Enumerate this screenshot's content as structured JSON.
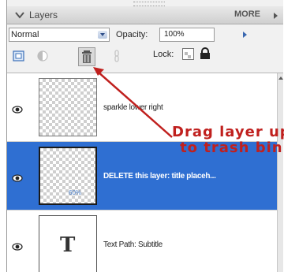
{
  "panel": {
    "title": "Layers",
    "more_label": "MORE",
    "blend_mode": "Normal",
    "opacity_label": "Opacity:",
    "opacity_value": "100%",
    "lock_label": "Lock:"
  },
  "toolbar": {
    "icons": [
      "new-layer-icon",
      "adjustment-layer-icon",
      "trash-icon",
      "link-icon",
      "lock-transparent-icon",
      "lock-all-icon"
    ]
  },
  "layers": [
    {
      "name": "sparkle lower right",
      "selected": false,
      "thumb": "transparent"
    },
    {
      "name": "DELETE this layer: title placeh...",
      "selected": true,
      "thumb": "transparent",
      "thumb_mark": "60%"
    },
    {
      "name": "Text Path: Subtitle",
      "selected": false,
      "thumb": "text",
      "thumb_glyph": "T"
    }
  ],
  "annotation": {
    "line1": "Drag layer up",
    "line2": "to trash bin",
    "color": "#c0201e"
  },
  "colors": {
    "selected_row": "#2f6fd2",
    "panel_bg": "#f1f1f1"
  }
}
